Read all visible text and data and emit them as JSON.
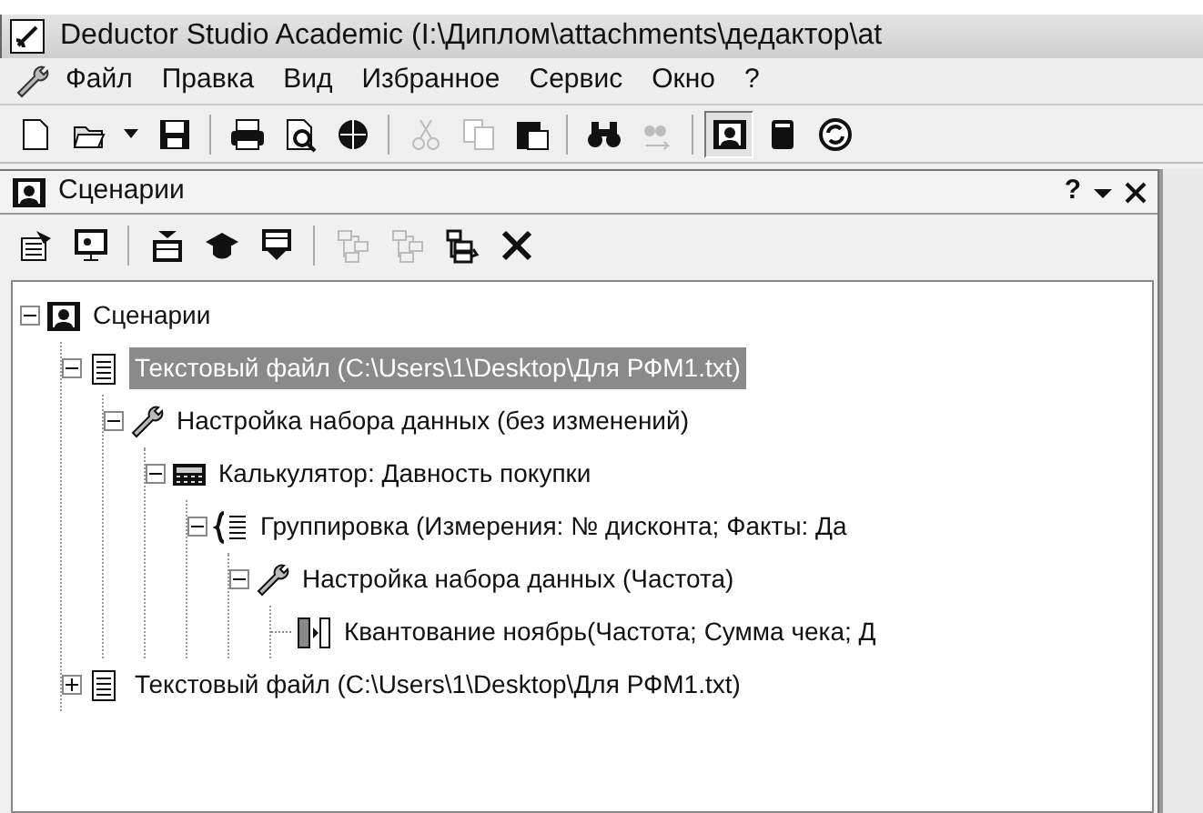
{
  "window": {
    "title": "Deductor Studio Academic (I:\\Диплом\\attachments\\дедактор\\at"
  },
  "menu": [
    "Файл",
    "Правка",
    "Вид",
    "Избранное",
    "Сервис",
    "Окно",
    "?"
  ],
  "toolbar": [
    {
      "kind": "new",
      "disabled": false,
      "selected": false
    },
    {
      "kind": "open",
      "disabled": false,
      "selected": false
    },
    {
      "kind": "caret",
      "disabled": false,
      "selected": false
    },
    {
      "kind": "save",
      "disabled": false,
      "selected": false
    },
    {
      "kind": "sep"
    },
    {
      "kind": "print",
      "disabled": false,
      "selected": false
    },
    {
      "kind": "preview",
      "disabled": false,
      "selected": false
    },
    {
      "kind": "globe",
      "disabled": false,
      "selected": false
    },
    {
      "kind": "sep"
    },
    {
      "kind": "cut",
      "disabled": true,
      "selected": false
    },
    {
      "kind": "copy",
      "disabled": true,
      "selected": false
    },
    {
      "kind": "paste",
      "disabled": false,
      "selected": false
    },
    {
      "kind": "sep"
    },
    {
      "kind": "find",
      "disabled": false,
      "selected": false
    },
    {
      "kind": "findnext",
      "disabled": true,
      "selected": false
    },
    {
      "kind": "sep"
    },
    {
      "kind": "scenario",
      "disabled": false,
      "selected": true
    },
    {
      "kind": "book",
      "disabled": false,
      "selected": false
    },
    {
      "kind": "refresh",
      "disabled": false,
      "selected": false
    }
  ],
  "panel": {
    "title": "Сценарии",
    "help": "?",
    "toolbar": [
      {
        "kind": "props",
        "disabled": false
      },
      {
        "kind": "screen",
        "disabled": false
      },
      {
        "kind": "sep"
      },
      {
        "kind": "import",
        "disabled": false
      },
      {
        "kind": "cap",
        "disabled": false
      },
      {
        "kind": "export",
        "disabled": false
      },
      {
        "kind": "sep"
      },
      {
        "kind": "treeup",
        "disabled": true
      },
      {
        "kind": "treedown",
        "disabled": true
      },
      {
        "kind": "treemove",
        "disabled": false
      },
      {
        "kind": "delete",
        "disabled": false
      }
    ],
    "tree": [
      {
        "label": "Сценарии",
        "kind": "scenario",
        "expanded": true,
        "selected": false,
        "children": [
          {
            "label": "Текстовый файл (C:\\Users\\1\\Desktop\\Для РФМ1.txt)",
            "kind": "file",
            "expanded": true,
            "selected": true,
            "children": [
              {
                "label": "Настройка набора данных (без изменений)",
                "kind": "wrench",
                "expanded": true,
                "selected": false,
                "children": [
                  {
                    "label": "Калькулятор: Давность покупки",
                    "kind": "calc",
                    "expanded": true,
                    "selected": false,
                    "children": [
                      {
                        "label": "Группировка (Измерения: № дисконта; Факты: Да",
                        "kind": "group",
                        "expanded": true,
                        "selected": false,
                        "children": [
                          {
                            "label": "Настройка набора данных (Частота)",
                            "kind": "wrench",
                            "expanded": true,
                            "selected": false,
                            "children": [
                              {
                                "label": "Квантование ноябрь(Частота; Сумма чека; Д",
                                "kind": "quant",
                                "selected": false
                              }
                            ]
                          }
                        ]
                      }
                    ]
                  }
                ]
              }
            ]
          },
          {
            "label": "Текстовый файл (C:\\Users\\1\\Desktop\\Для РФМ1.txt)",
            "kind": "file",
            "expanded": false,
            "selected": false
          }
        ]
      }
    ]
  }
}
